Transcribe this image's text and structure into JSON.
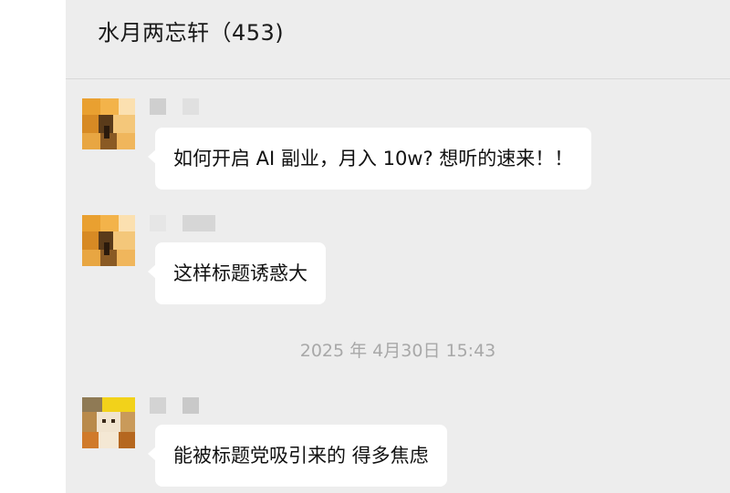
{
  "header": {
    "title": "水月两忘轩（453)"
  },
  "messages": [
    {
      "text": "如何开启 AI 副业，月入 10w? 想听的速来！！"
    },
    {
      "text": "这样标题诱惑大"
    },
    {
      "text": "能被标题党吸引来的 得多焦虑"
    }
  ],
  "divider": {
    "timestamp": "2025 年 4月30日 15:43"
  },
  "colors": {
    "chat_background": "#ededed",
    "bubble": "#ffffff",
    "timestamp": "#a8a8a8"
  },
  "icons": [
    "avatar-orange-icon",
    "avatar-yellow-icon"
  ]
}
